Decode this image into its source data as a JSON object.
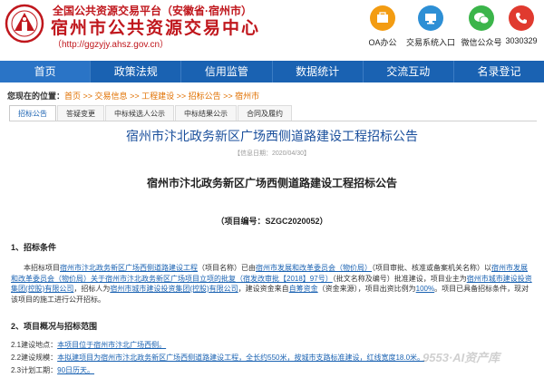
{
  "header": {
    "org_line": "全国公共资源交易平台（安徽省·宿州市）",
    "site_name": "宿州市公共资源交易中心",
    "url_line": "（http://ggzyjy.ahsz.gov.cn）",
    "quick_links": [
      {
        "label": "OA办公",
        "icon": "oa-icon",
        "color": "#f39c12"
      },
      {
        "label": "交易系统入口",
        "icon": "trading-system-icon",
        "color": "#2d8fd5"
      },
      {
        "label": "微信公众号",
        "icon": "wechat-icon",
        "color": "#3bb54a"
      },
      {
        "label": "3030329",
        "icon": "phone-icon",
        "color": "#e03a2f"
      }
    ]
  },
  "nav": {
    "items": [
      "首页",
      "政策法规",
      "信用监管",
      "数据统计",
      "交流互动",
      "名录登记"
    ]
  },
  "breadcrumb": {
    "prefix": "您现在的位置：",
    "home": "首页",
    "sep": " >> ",
    "links": [
      "交易信息",
      "工程建设",
      "招标公告"
    ],
    "current": "宿州市"
  },
  "tabs": [
    "招标公告",
    "答疑变更",
    "中标候选人公示",
    "中标结果公示",
    "合同及履约"
  ],
  "article": {
    "title": "宿州市汴北政务新区广场西侧道路建设工程招标公告",
    "info_date": "【信息日期：2020/04/30】",
    "doc_title": "宿州市汴北政务新区广场西侧道路建设工程招标公告",
    "project_no": "（项目编号：SZGC2020052）",
    "section1_title": "1、招标条件",
    "section1_parts": [
      {
        "text": "本招标项目",
        "u": false
      },
      {
        "text": "宿州市汴北政务新区广场西侧道路建设工程",
        "u": true
      },
      {
        "text": "（项目名称）已由",
        "u": false
      },
      {
        "text": "宿州市发展和改革委员会（物价局）",
        "u": true
      },
      {
        "text": "（项目审批、核准或备案机关名称）以",
        "u": false
      },
      {
        "text": "宿州市发展和改革委员会（物价局）关于宿州市汴北政务新区广场项目立项的批复（宿发改审批【2018】97号）",
        "u": true
      },
      {
        "text": "（批文名称及编号）批准建设，项目业主为",
        "u": false
      },
      {
        "text": "宿州市城市建设投资集团(控股)有限公司",
        "u": true
      },
      {
        "text": "，招标人为",
        "u": false
      },
      {
        "text": "宿州市城市建设投资集团(控股)有限公司",
        "u": true
      },
      {
        "text": "，建设资金来自",
        "u": false
      },
      {
        "text": "自筹资金",
        "u": true
      },
      {
        "text": "（资金来源），项目出资比例为",
        "u": false
      },
      {
        "text": "100%",
        "u": true
      },
      {
        "text": "。项目已具备招标条件，现对该项目的施工进行公开招标。",
        "u": false
      }
    ],
    "section2_title": "2、项目概况与招标范围",
    "items": [
      {
        "label": "2.1建设地点：",
        "value": "本项目位于宿州市汴北广场西侧。"
      },
      {
        "label": "2.2建设规模：",
        "value": "本拟建项目为宿州市汴北政务新区广场西侧道路建设工程，全长约550米，按城市支路标准建设，红线宽度18.0米。"
      },
      {
        "label": "2.3计划工期：",
        "value": "90日历天。"
      }
    ]
  },
  "watermark": "9553·AI资产库",
  "colors": {
    "brand_red": "#c0171d",
    "nav_blue": "#1a62b2",
    "link_orange": "#e07000",
    "title_blue": "#1a4f9c"
  }
}
